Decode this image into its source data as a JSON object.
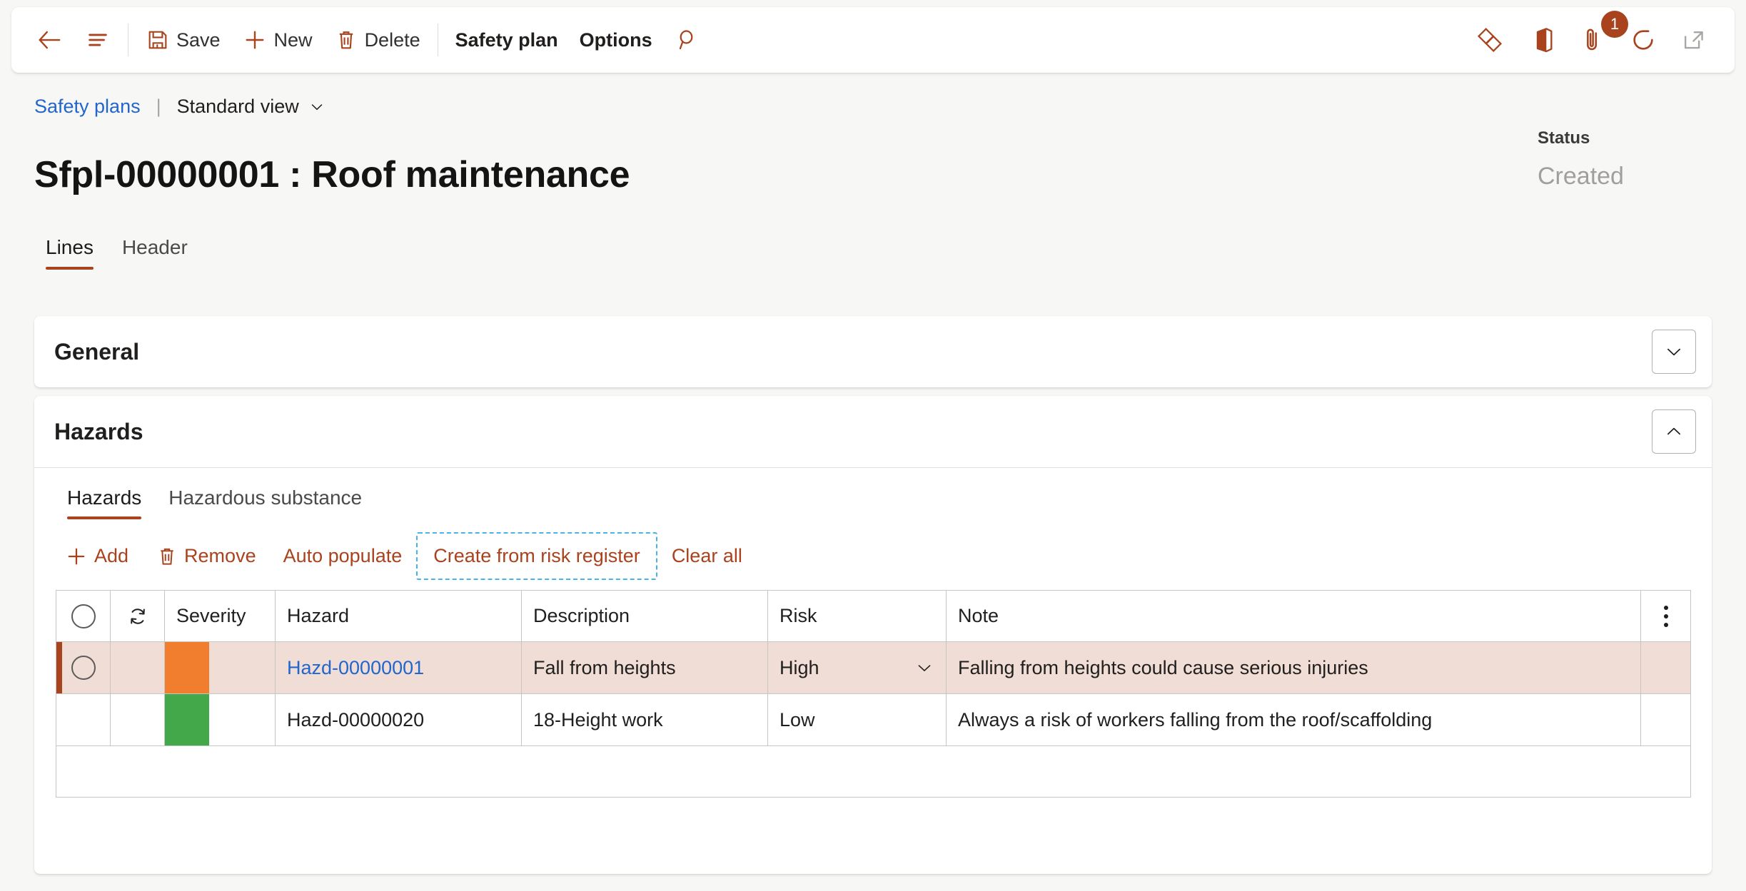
{
  "theme": {
    "accent": "#a9431e",
    "link": "#2266cc",
    "page_bg": "#f7f7f5",
    "selected_row_bg": "#f0ddd6",
    "severity_high": "#f07e2e",
    "severity_low": "#42a84a",
    "focus_outline": "#4ab3e8"
  },
  "commandbar": {
    "back": {
      "label": "Back",
      "icon": "back-arrow-icon"
    },
    "menu": {
      "label": "Show navigation",
      "icon": "hamburger-icon"
    },
    "buttons": [
      {
        "label": "Save",
        "icon": "save-icon",
        "name": "save-button"
      },
      {
        "label": "New",
        "icon": "plus-icon",
        "name": "new-button"
      },
      {
        "label": "Delete",
        "icon": "trash-icon",
        "name": "delete-button"
      }
    ],
    "menus": [
      {
        "label": "Safety plan",
        "name": "safety-plan-menu"
      },
      {
        "label": "Options",
        "name": "options-menu"
      }
    ],
    "search": {
      "label": "Search",
      "icon": "search-icon"
    },
    "right_icons": [
      {
        "name": "power-bi-icon",
        "label": "Power Platform"
      },
      {
        "name": "office-icon",
        "label": "Open in Office"
      },
      {
        "name": "attachment-icon",
        "label": "Attachments",
        "badge": "1"
      },
      {
        "name": "refresh-icon",
        "label": "Refresh"
      },
      {
        "name": "popout-icon",
        "label": "Open in new window"
      }
    ]
  },
  "breadcrumb": {
    "parent": "Safety plans",
    "divider": "|",
    "view": "Standard view",
    "chevron": "chevron-down-icon"
  },
  "header": {
    "title": "Sfpl-00000001 : Roof maintenance",
    "status_label": "Status",
    "status_value": "Created"
  },
  "page_tabs": [
    {
      "label": "Lines",
      "active": true
    },
    {
      "label": "Header",
      "active": false
    }
  ],
  "sections": {
    "general": {
      "title": "General",
      "expanded": false,
      "chevron": "chevron-down-icon"
    },
    "hazards": {
      "title": "Hazards",
      "expanded": true,
      "chevron": "chevron-up-icon"
    }
  },
  "inner_tabs": [
    {
      "label": "Hazards",
      "active": true
    },
    {
      "label": "Hazardous substance",
      "active": false
    }
  ],
  "grid_toolbar": [
    {
      "label": "Add",
      "icon": "plus-icon",
      "focused": false,
      "name": "add-button"
    },
    {
      "label": "Remove",
      "icon": "trash-icon",
      "focused": false,
      "name": "remove-button"
    },
    {
      "label": "Auto populate",
      "icon": null,
      "focused": false,
      "name": "auto-populate-button"
    },
    {
      "label": "Create from risk register",
      "icon": null,
      "focused": true,
      "name": "create-from-risk-register-button"
    },
    {
      "label": "Clear all",
      "icon": null,
      "focused": false,
      "name": "clear-all-button"
    }
  ],
  "grid": {
    "columns": [
      {
        "label": "",
        "key": "select",
        "type": "select-header"
      },
      {
        "label": "",
        "key": "refresh",
        "type": "icon-header",
        "icon": "sync-icon"
      },
      {
        "label": "Severity",
        "key": "severity"
      },
      {
        "label": "Hazard",
        "key": "hazard"
      },
      {
        "label": "Description",
        "key": "description"
      },
      {
        "label": "Risk",
        "key": "risk"
      },
      {
        "label": "Note",
        "key": "note"
      },
      {
        "label": "",
        "key": "overflow",
        "type": "overflow",
        "icon": "more-vertical-icon"
      }
    ],
    "rows": [
      {
        "selected": true,
        "severity_color": "#f07e2e",
        "hazard": "Hazd-00000001",
        "hazard_is_link": true,
        "description": "Fall from heights",
        "risk": "High",
        "risk_has_dropdown": true,
        "note": "Falling from heights could cause serious injuries"
      },
      {
        "selected": false,
        "severity_color": "#42a84a",
        "hazard": "Hazd-00000020",
        "hazard_is_link": false,
        "description": "18-Height work",
        "risk": "Low",
        "risk_has_dropdown": false,
        "note": "Always a risk of workers falling from the roof/scaffolding"
      }
    ]
  }
}
